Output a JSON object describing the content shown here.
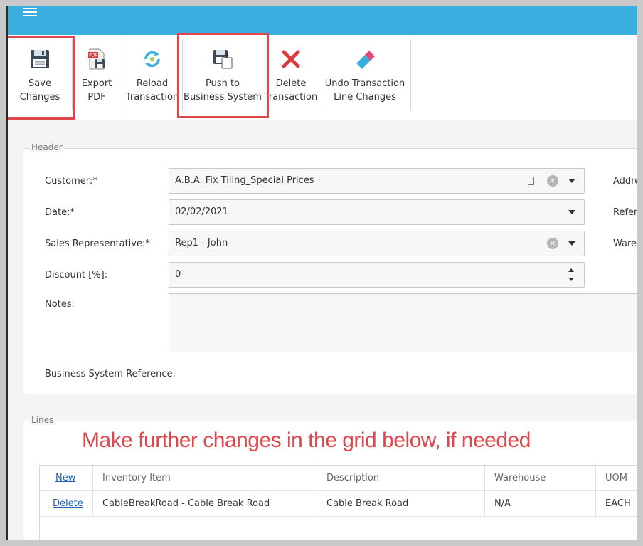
{
  "toolbar": {
    "save": {
      "line1": "Save",
      "line2": "Changes"
    },
    "export": {
      "line1": "Export",
      "line2": "PDF"
    },
    "reload": {
      "line1": "Reload",
      "line2": "Transaction"
    },
    "push": {
      "line1": "Push to",
      "line2": "Business System"
    },
    "delete": {
      "line1": "Delete",
      "line2": "Transaction"
    },
    "undo": {
      "line1": "Undo Transaction",
      "line2": "Line Changes"
    }
  },
  "header": {
    "legend": "Header",
    "customer_label": "Customer:*",
    "customer_value": "A.B.A. Fix Tiling_Special Prices",
    "date_label": "Date:*",
    "date_value": "02/02/2021",
    "salesrep_label": "Sales Representative:*",
    "salesrep_value": "Rep1 - John",
    "discount_label": "Discount [%]:",
    "discount_value": "0",
    "notes_label": "Notes:",
    "bsr_label": "Business System Reference:",
    "address_label": "Addre",
    "reference_label": "Refer",
    "warehouse_label": "Wareh"
  },
  "lines": {
    "legend": "Lines",
    "annotation": "Make further changes in the grid below, if needed",
    "columns": {
      "action": "New",
      "item": "Inventory Item",
      "desc": "Description",
      "wh": "Warehouse",
      "uom": "UOM"
    },
    "rows": [
      {
        "action": "Delete",
        "item": "CableBreakRoad - Cable Break Road",
        "desc": "Cable Break Road",
        "wh": "N/A",
        "uom": "EACH"
      }
    ]
  },
  "colors": {
    "topbar": "#3aaede",
    "highlight": "#e0474c",
    "link": "#1a5fb4"
  }
}
